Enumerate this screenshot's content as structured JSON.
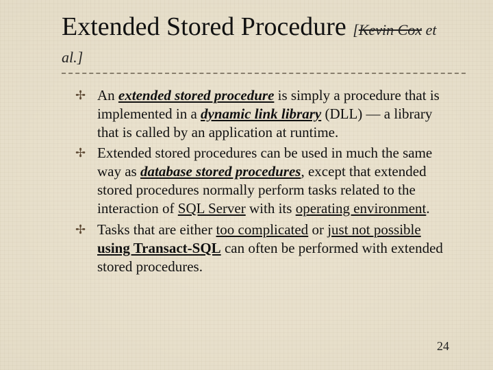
{
  "title": {
    "main": "Extended Stored Procedure",
    "attribution_open": "[",
    "attribution_strike": "Kevin Cox",
    "attribution_tail": " et al.]"
  },
  "bullets": [
    {
      "t1": "An ",
      "bi1": "extended stored procedure",
      "t2": " is simply a procedure that is implemented in a ",
      "bi2": "dynamic link library",
      "t3": " (DLL) — a library that is called by an application at runtime."
    },
    {
      "t1": "Extended stored procedures can be used in much the same way as ",
      "bi1": "database stored procedures",
      "t2": ", except that extended stored procedures normally perform tasks related to the interaction of ",
      "u1": "SQL Server",
      "t3": " with its ",
      "u2": "operating environment",
      "t4": "."
    },
    {
      "t1": "Tasks that are either ",
      "u1": "too complicated",
      "t2": " or ",
      "u2": "just not possible",
      "t3": " ",
      "ub1": "using Transact-SQL",
      "t4": " can often be performed with extended stored procedures."
    }
  ],
  "page_number": "24"
}
